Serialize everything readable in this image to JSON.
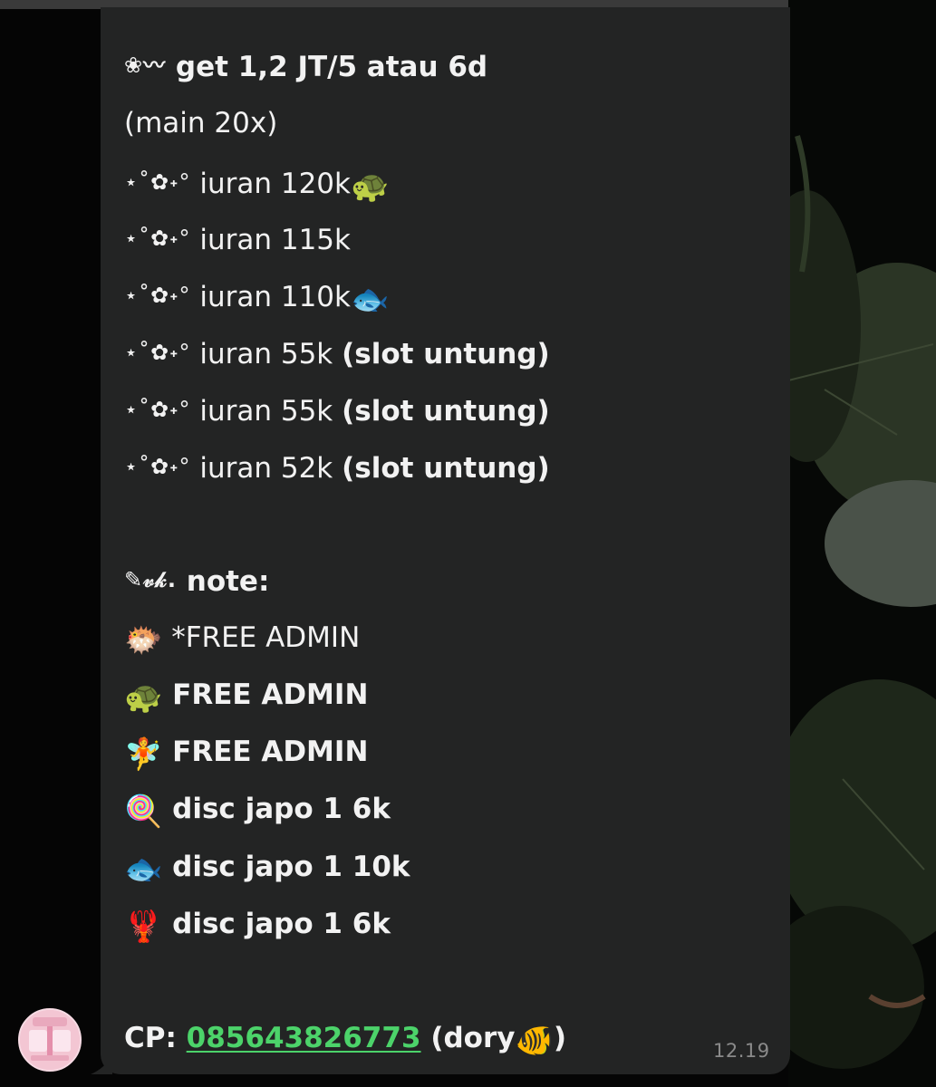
{
  "message": {
    "lines": [
      {
        "prefix": "❀⁠〰︎",
        "text": "get 1,2 JT/5 atau 6d",
        "bold": true
      },
      {
        "prefix": "",
        "text": "(main 20x)"
      },
      {
        "prefix": "⋆˚✿˖°",
        "text": "iuran 120k",
        "emoji": "🐢"
      },
      {
        "prefix": "⋆˚✿˖°",
        "text": "iuran 115k"
      },
      {
        "prefix": "⋆˚✿˖°",
        "text": "iuran 110k",
        "emoji": "🐟"
      },
      {
        "prefix": "⋆˚✿˖°",
        "text": "iuran 55k",
        "suffix": "(slot untung)"
      },
      {
        "prefix": "⋆˚✿˖°",
        "text": "iuran 55k",
        "suffix": "(slot untung)"
      },
      {
        "prefix": "⋆˚✿˖°",
        "text": "iuran 52k",
        "suffix": "(slot untung)"
      }
    ],
    "note_heading": {
      "prefix": "✎𝓋𝓀.",
      "text": "note:"
    },
    "notes": [
      {
        "emoji": "🐡",
        "text": "*FREE ADMIN"
      },
      {
        "emoji": "🐢",
        "text": "FREE ADMIN"
      },
      {
        "emoji": "🧚",
        "text": "FREE ADMIN"
      },
      {
        "emoji": "🍭",
        "text": "disc japo 1 6k"
      },
      {
        "emoji": "🐟",
        "text": "disc japo 1 10k"
      },
      {
        "emoji": "🦞",
        "text": "disc japo 1 6k"
      }
    ],
    "contact": {
      "label": "CP:",
      "phone": "085643826773",
      "name_open": "(dory",
      "name_emoji": "🐠",
      "name_close": ")"
    },
    "timestamp": "12.19"
  },
  "colors": {
    "bubble": "#232424",
    "text": "#f2f2f2",
    "link": "#4cd36a",
    "timestamp": "#8a8a8a",
    "avatar": "#f3c6d3"
  },
  "icons": {
    "avatar": "sender-avatar"
  }
}
